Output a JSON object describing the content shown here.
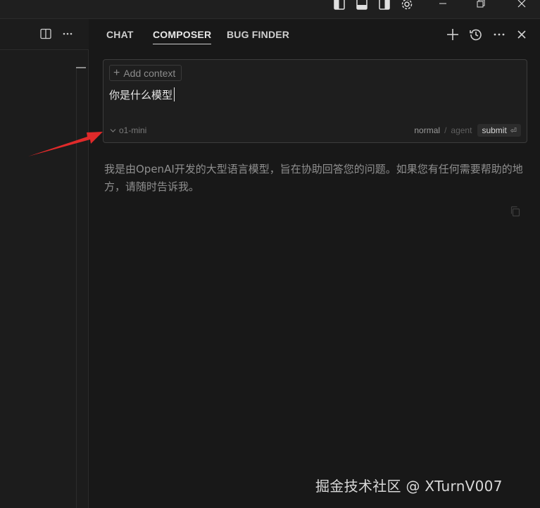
{
  "window": {
    "controls": [
      "layout-sidebar-left-icon",
      "layout-panel-icon",
      "layout-sidebar-right-icon",
      "gear-icon",
      "minimize-icon",
      "restore-icon",
      "close-icon"
    ]
  },
  "left_toolbar": {
    "icons": [
      "split-editor-icon",
      "more-icon"
    ]
  },
  "panel": {
    "tabs": [
      {
        "label": "CHAT",
        "active": false
      },
      {
        "label": "COMPOSER",
        "active": true
      },
      {
        "label": "BUG FINDER",
        "active": false
      }
    ],
    "actions": [
      "plus-icon",
      "history-icon",
      "more-icon",
      "close-icon"
    ]
  },
  "composer": {
    "add_context_label": "Add context",
    "input_value": "你是什么模型",
    "model": "o1-mini",
    "mode_normal": "normal",
    "mode_separator": "/",
    "mode_agent": "agent",
    "submit_label": "submit",
    "submit_key": "⏎"
  },
  "response": {
    "text": "我是由OpenAI开发的大型语言模型，旨在协助回答您的问题。如果您有任何需要帮助的地方，请随时告诉我。"
  },
  "watermark": {
    "text": "掘金技术社区 @ XTurnV007"
  },
  "colors": {
    "background": "#181818",
    "annotation_arrow": "#e02a2a",
    "active_tab_underline": "#d0d0d0"
  }
}
